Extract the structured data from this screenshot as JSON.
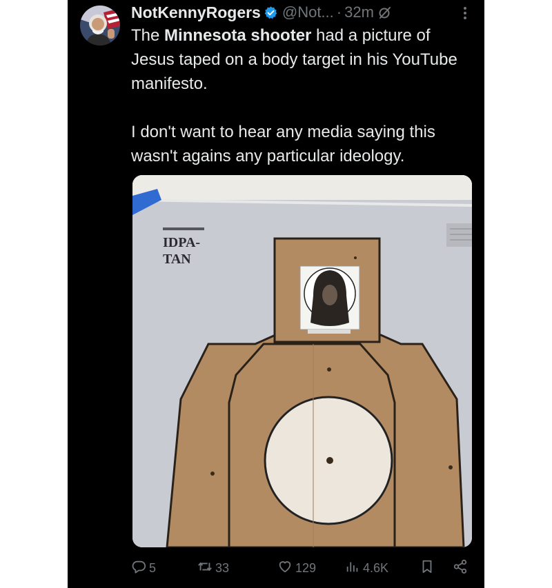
{
  "tweet": {
    "author_name": "NotKennyRogers",
    "handle": "@Not...",
    "separator": "·",
    "time": "32m",
    "text_p1_pre": "The ",
    "text_p1_bold": "Minnesota shooter",
    "text_p1_post": " had a picture of Jesus taped on a body target in his YouTube manifesto.",
    "text_p2": "I don't want to hear any media saying this wasn't agains any particular ideology."
  },
  "media": {
    "target_label_line1": "IDPA-",
    "target_label_line2": "TAN"
  },
  "actions": {
    "replies": "5",
    "reposts": "33",
    "likes": "129",
    "views": "4.6K"
  },
  "colors": {
    "background": "#000000",
    "text": "#e7e9ea",
    "muted": "#71767b",
    "verified": "#1d9bf0"
  },
  "icons": [
    "verified-badge-icon",
    "edited-icon",
    "more-icon",
    "reply-icon",
    "repost-icon",
    "like-icon",
    "views-icon",
    "bookmark-icon",
    "share-icon"
  ]
}
